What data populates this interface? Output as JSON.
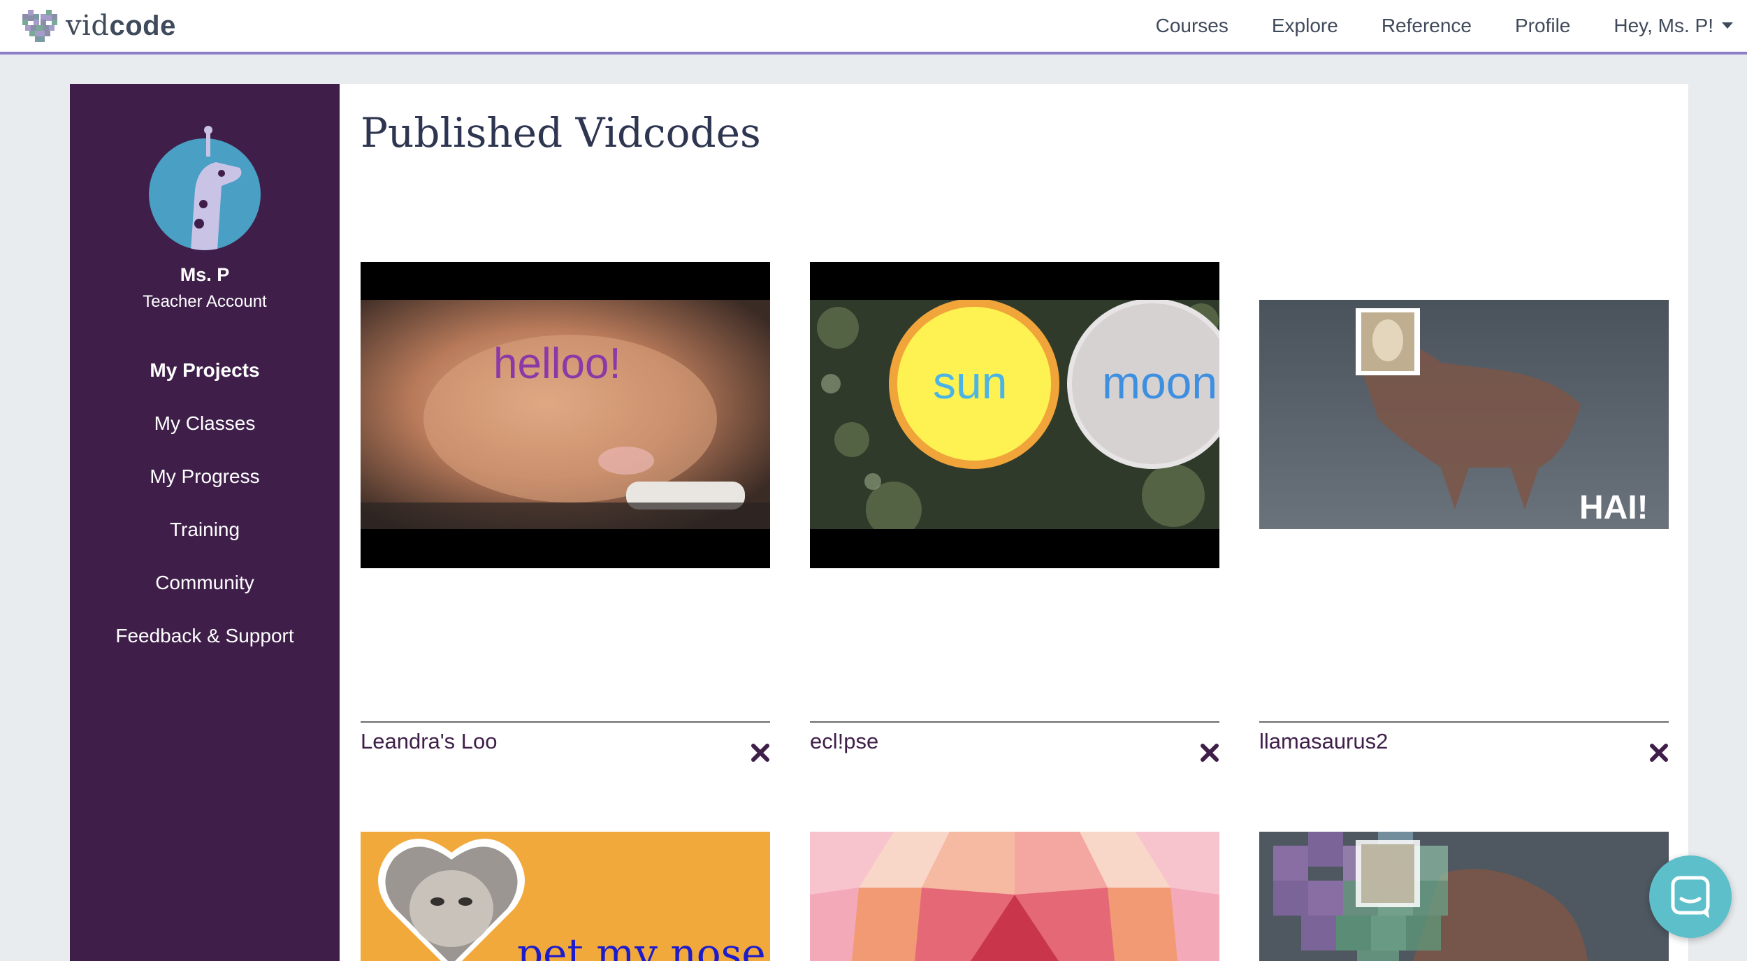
{
  "app": {
    "logo_text_light": "vid",
    "logo_text_bold": "code",
    "brand_color": "#3f1f4a",
    "accent_color": "#8c7fc8"
  },
  "nav": {
    "items": [
      "Courses",
      "Explore",
      "Reference",
      "Profile"
    ],
    "user_menu": "Hey, Ms. P!"
  },
  "sidebar": {
    "user_name": "Ms. P",
    "account_type": "Teacher Account",
    "items": [
      {
        "label": "My Projects",
        "active": true
      },
      {
        "label": "My Classes",
        "active": false
      },
      {
        "label": "My Progress",
        "active": false
      },
      {
        "label": "Training",
        "active": false
      },
      {
        "label": "Community",
        "active": false
      },
      {
        "label": "Feedback & Support",
        "active": false
      }
    ]
  },
  "main": {
    "title": "Published Vidcodes",
    "projects": [
      {
        "title": "Leandra's Loo",
        "caption": "helloo!"
      },
      {
        "title": "ecl!pse",
        "caption_sun": "sun",
        "caption_moon": "moon"
      },
      {
        "title": "llamasaurus2",
        "caption": "HAI!"
      },
      {
        "title": "",
        "caption": "pet my nose"
      },
      {
        "title": ""
      },
      {
        "title": ""
      }
    ]
  },
  "icons": {
    "delete": "close-x-icon",
    "chat": "chat-bubble-icon",
    "user_menu_caret": "caret-down-icon"
  }
}
